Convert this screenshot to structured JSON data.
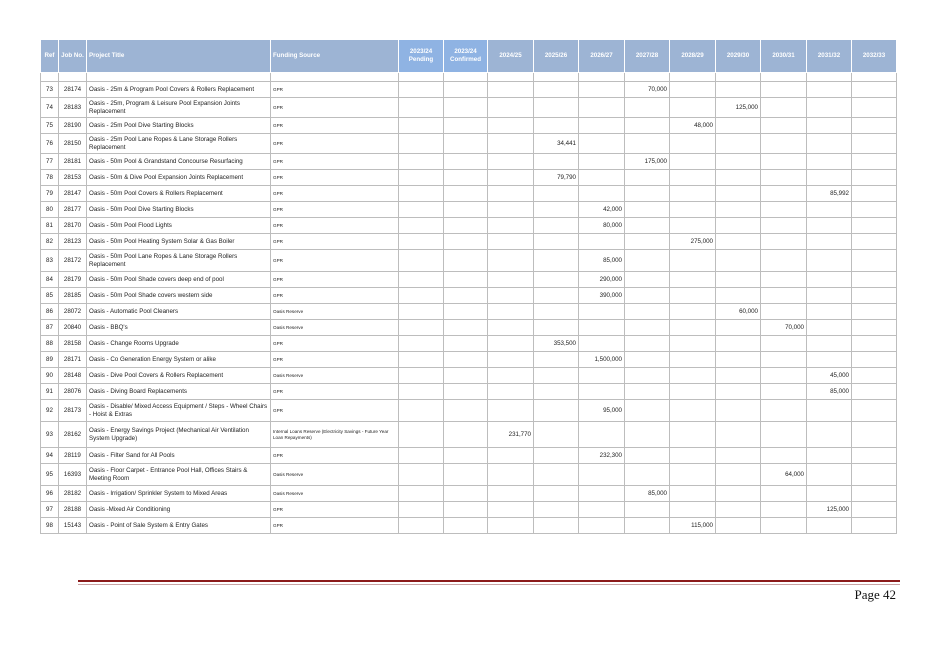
{
  "table": {
    "headers": [
      "Ref",
      "Job No.",
      "Project Title",
      "Funding Source",
      "2023/24 Pending",
      "2023/24 Confirmed",
      "2024/25",
      "2025/26",
      "2026/27",
      "2027/28",
      "2028/29",
      "2029/30",
      "2030/31",
      "2031/32",
      "2032/33"
    ],
    "rows": [
      {
        "ref": "73",
        "job": "28174",
        "title": "Oasis - 25m & Program Pool Covers & Rollers Replacement",
        "fund": "GPR",
        "vals": [
          "",
          "",
          "",
          "",
          "",
          "70,000",
          "",
          "",
          "",
          "",
          ""
        ]
      },
      {
        "ref": "74",
        "job": "28183",
        "title": "Oasis - 25m, Program & Leisure Pool Expansion Joints Replacement",
        "fund": "GPR",
        "vals": [
          "",
          "",
          "",
          "",
          "",
          "",
          "",
          "125,000",
          "",
          "",
          ""
        ]
      },
      {
        "ref": "75",
        "job": "28190",
        "title": "Oasis - 25m Pool Dive Starting Blocks",
        "fund": "GPR",
        "vals": [
          "",
          "",
          "",
          "",
          "",
          "",
          "48,000",
          "",
          "",
          "",
          ""
        ]
      },
      {
        "ref": "76",
        "job": "28150",
        "title": "Oasis - 25m Pool Lane Ropes & Lane Storage Rollers Replacement",
        "fund": "GPR",
        "vals": [
          "",
          "",
          "",
          "34,441",
          "",
          "",
          "",
          "",
          "",
          "",
          ""
        ]
      },
      {
        "ref": "77",
        "job": "28181",
        "title": "Oasis - 50m Pool & Grandstand Concourse Resurfacing",
        "fund": "GPR",
        "vals": [
          "",
          "",
          "",
          "",
          "",
          "175,000",
          "",
          "",
          "",
          "",
          ""
        ]
      },
      {
        "ref": "78",
        "job": "28153",
        "title": "Oasis - 50m & Dive Pool Expansion Joints Replacement",
        "fund": "GPR",
        "vals": [
          "",
          "",
          "",
          "79,790",
          "",
          "",
          "",
          "",
          "",
          "",
          ""
        ]
      },
      {
        "ref": "79",
        "job": "28147",
        "title": "Oasis - 50m Pool Covers & Rollers Replacement",
        "fund": "GPR",
        "vals": [
          "",
          "",
          "",
          "",
          "",
          "",
          "",
          "",
          "",
          "85,992",
          ""
        ]
      },
      {
        "ref": "80",
        "job": "28177",
        "title": "Oasis - 50m Pool Dive Starting Blocks",
        "fund": "GPR",
        "vals": [
          "",
          "",
          "",
          "",
          "42,000",
          "",
          "",
          "",
          "",
          "",
          ""
        ]
      },
      {
        "ref": "81",
        "job": "28170",
        "title": "Oasis - 50m Pool Flood Lights",
        "fund": "GPR",
        "vals": [
          "",
          "",
          "",
          "",
          "80,000",
          "",
          "",
          "",
          "",
          "",
          ""
        ]
      },
      {
        "ref": "82",
        "job": "28123",
        "title": "Oasis - 50m Pool Heating System Solar & Gas Boiler",
        "fund": "GPR",
        "vals": [
          "",
          "",
          "",
          "",
          "",
          "",
          "275,000",
          "",
          "",
          "",
          ""
        ]
      },
      {
        "ref": "83",
        "job": "28172",
        "title": "Oasis - 50m Pool Lane Ropes & Lane Storage Rollers Replacement",
        "fund": "GPR",
        "vals": [
          "",
          "",
          "",
          "",
          "85,000",
          "",
          "",
          "",
          "",
          "",
          ""
        ]
      },
      {
        "ref": "84",
        "job": "28179",
        "title": "Oasis - 50m Pool Shade covers deep end of pool",
        "fund": "GPR",
        "vals": [
          "",
          "",
          "",
          "",
          "290,000",
          "",
          "",
          "",
          "",
          "",
          ""
        ]
      },
      {
        "ref": "85",
        "job": "28185",
        "title": "Oasis - 50m Pool Shade covers western side",
        "fund": "GPR",
        "vals": [
          "",
          "",
          "",
          "",
          "390,000",
          "",
          "",
          "",
          "",
          "",
          ""
        ]
      },
      {
        "ref": "86",
        "job": "28072",
        "title": "Oasis - Automatic Pool Cleaners",
        "fund": "Oasis Reserve",
        "vals": [
          "",
          "",
          "",
          "",
          "",
          "",
          "",
          "60,000",
          "",
          "",
          ""
        ]
      },
      {
        "ref": "87",
        "job": "20840",
        "title": "Oasis - BBQ's",
        "fund": "Oasis Reserve",
        "vals": [
          "",
          "",
          "",
          "",
          "",
          "",
          "",
          "",
          "70,000",
          "",
          ""
        ]
      },
      {
        "ref": "88",
        "job": "28158",
        "title": "Oasis - Change Rooms Upgrade",
        "fund": "GPR",
        "vals": [
          "",
          "",
          "",
          "353,500",
          "",
          "",
          "",
          "",
          "",
          "",
          ""
        ]
      },
      {
        "ref": "89",
        "job": "28171",
        "title": "Oasis - Co Generation Energy System or alike",
        "fund": "GPR",
        "vals": [
          "",
          "",
          "",
          "",
          "1,500,000",
          "",
          "",
          "",
          "",
          "",
          ""
        ]
      },
      {
        "ref": "90",
        "job": "28148",
        "title": "Oasis - Dive Pool Covers & Rollers Replacement",
        "fund": "Oasis Reserve",
        "vals": [
          "",
          "",
          "",
          "",
          "",
          "",
          "",
          "",
          "",
          "45,000",
          ""
        ]
      },
      {
        "ref": "91",
        "job": "28076",
        "title": "Oasis - Diving Board Replacements",
        "fund": "GPR",
        "vals": [
          "",
          "",
          "",
          "",
          "",
          "",
          "",
          "",
          "",
          "85,000",
          ""
        ]
      },
      {
        "ref": "92",
        "job": "28173",
        "title": "Oasis - Disable/ Mixed Access Equipment / Steps - Wheel Chairs - Hoist & Extras",
        "fund": "GPR",
        "vals": [
          "",
          "",
          "",
          "",
          "95,000",
          "",
          "",
          "",
          "",
          "",
          ""
        ]
      },
      {
        "ref": "93",
        "job": "28162",
        "title": "Oasis - Energy Savings Project (Mechanical Air Ventilation System Upgrade)",
        "fund": "Internal Loans Reserve (Electricity Savings - Future Year Loan Repayments)",
        "vals": [
          "",
          "",
          "231,770",
          "",
          "",
          "",
          "",
          "",
          "",
          "",
          ""
        ]
      },
      {
        "ref": "94",
        "job": "28119",
        "title": "Oasis - Filter Sand for All Pools",
        "fund": "GPR",
        "vals": [
          "",
          "",
          "",
          "",
          "232,300",
          "",
          "",
          "",
          "",
          "",
          ""
        ]
      },
      {
        "ref": "95",
        "job": "16393",
        "title": "Oasis - Floor Carpet - Entrance Pool Hall, Offices Stairs & Meeting Room",
        "fund": "Oasis Reserve",
        "vals": [
          "",
          "",
          "",
          "",
          "",
          "",
          "",
          "",
          "64,000",
          "",
          ""
        ]
      },
      {
        "ref": "96",
        "job": "28182",
        "title": "Oasis - Irrigation/ Sprinkler System to Mixed Areas",
        "fund": "Oasis Reserve",
        "vals": [
          "",
          "",
          "",
          "",
          "",
          "85,000",
          "",
          "",
          "",
          "",
          ""
        ]
      },
      {
        "ref": "97",
        "job": "28188",
        "title": "Oasis -Mixed Air Conditioning",
        "fund": "GPR",
        "vals": [
          "",
          "",
          "",
          "",
          "",
          "",
          "",
          "",
          "",
          "125,000",
          ""
        ]
      },
      {
        "ref": "98",
        "job": "15143",
        "title": "Oasis - Point of Sale System & Entry Gates",
        "fund": "GPR",
        "vals": [
          "",
          "",
          "",
          "",
          "",
          "",
          "115,000",
          "",
          "",
          "",
          ""
        ]
      }
    ]
  },
  "footer": {
    "page_label": "Page 42"
  }
}
